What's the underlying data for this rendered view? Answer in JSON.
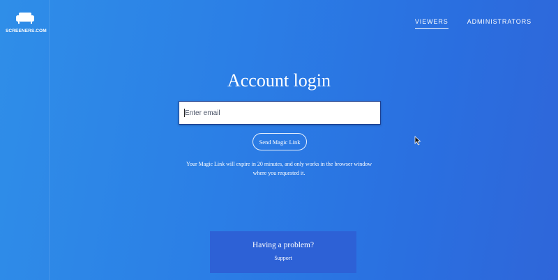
{
  "brand": {
    "logo_text": "SCREENERS.COM",
    "logo_icon": "sofa-icon"
  },
  "nav": {
    "items": [
      {
        "label": "VIEWERS",
        "active": true
      },
      {
        "label": "ADMINISTRATORS",
        "active": false
      }
    ]
  },
  "login": {
    "title": "Account login",
    "email_placeholder": "Enter email",
    "email_value": "",
    "send_button_label": "Send Magic Link",
    "note": "Your Magic Link will expire in 20 minutes, and only works in the browser window where you requested it."
  },
  "help": {
    "title": "Having a problem?",
    "support_label": "Support"
  },
  "colors": {
    "background_start": "#2f8ee8",
    "background_end": "#2f66d9",
    "help_box": "#2d61d6",
    "text": "#ffffff"
  }
}
